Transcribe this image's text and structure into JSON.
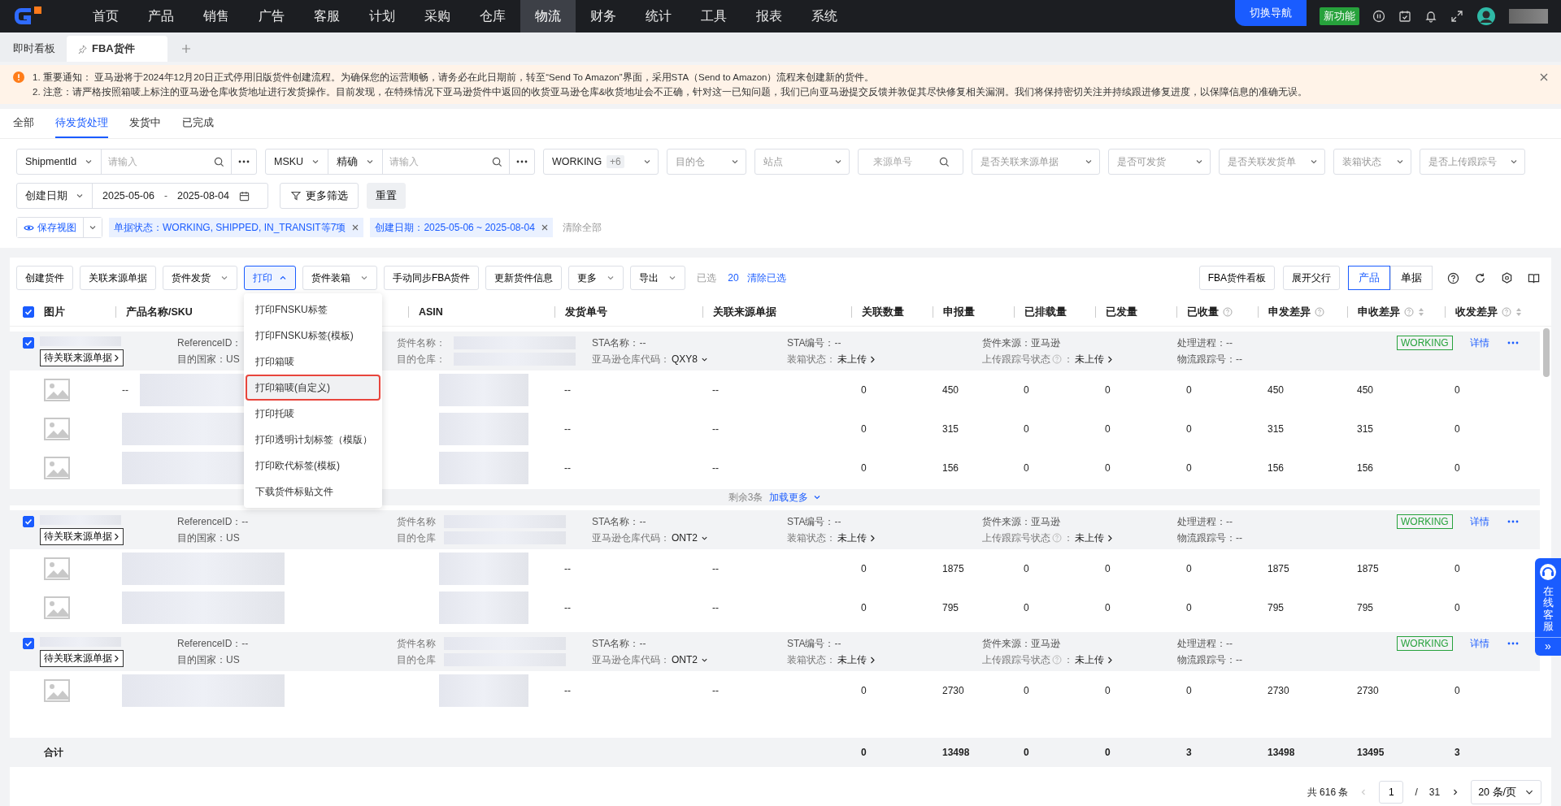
{
  "nav": {
    "menu": [
      {
        "label": "首页",
        "selected": false
      },
      {
        "label": "产品",
        "selected": false
      },
      {
        "label": "销售",
        "selected": false
      },
      {
        "label": "广告",
        "selected": false
      },
      {
        "label": "客服",
        "selected": false
      },
      {
        "label": "计划",
        "selected": false
      },
      {
        "label": "采购",
        "selected": false
      },
      {
        "label": "仓库",
        "selected": false
      },
      {
        "label": "物流",
        "selected": true
      },
      {
        "label": "财务",
        "selected": false
      },
      {
        "label": "统计",
        "selected": false
      },
      {
        "label": "工具",
        "selected": false
      },
      {
        "label": "报表",
        "selected": false
      },
      {
        "label": "系统",
        "selected": false
      }
    ],
    "switch_button": "切换导航",
    "new_feature": "新功能"
  },
  "page_tabs": [
    {
      "label": "即时看板",
      "selected": false,
      "pinned": false
    },
    {
      "label": "FBA货件",
      "selected": true,
      "pinned": true
    }
  ],
  "notices": [
    "1. 重要通知： 亚马逊将于2024年12月20日正式停用旧版货件创建流程。为确保您的运营顺畅，请务必在此日期前，转至“Send To Amazon”界面，采用STA（Send to Amazon）流程来创建新的货件。",
    "2. 注意：请严格按照箱唛上标注的亚马逊仓库收货地址进行发货操作。目前发现，在特殊情况下亚马逊货件中返回的收货亚马逊仓库&收货地址会不正确，针对这一已知问题，我们已向亚马逊提交反馈并敦促其尽快修复相关漏洞。我们将保持密切关注并持续跟进修复进度，以保障信息的准确无误。"
  ],
  "status_tabs": [
    {
      "label": "全部",
      "selected": false
    },
    {
      "label": "待发货处理",
      "selected": true
    },
    {
      "label": "发货中",
      "selected": false
    },
    {
      "label": "已完成",
      "selected": false
    }
  ],
  "filters": [
    {
      "kind": "combo",
      "select": "ShipmentId",
      "placeholder": "请输入"
    },
    {
      "kind": "combo",
      "select": "MSKU",
      "mode": "精确",
      "placeholder": "请输入"
    },
    {
      "kind": "select",
      "value": "WORKING",
      "count": "+6"
    },
    {
      "kind": "select",
      "placeholder": "目的仓"
    },
    {
      "kind": "select",
      "placeholder": "站点"
    },
    {
      "kind": "search",
      "placeholder": "来源单号"
    },
    {
      "kind": "select",
      "placeholder": "是否关联来源单据"
    },
    {
      "kind": "select",
      "placeholder": "是否可发货"
    },
    {
      "kind": "select",
      "placeholder": "是否关联发货单"
    },
    {
      "kind": "select",
      "placeholder": "装箱状态"
    },
    {
      "kind": "select",
      "placeholder": "是否上传跟踪号"
    },
    {
      "kind": "daterange",
      "select": "创建日期",
      "start": "2025-05-06",
      "sep": "-",
      "end": "2025-08-04"
    },
    {
      "kind": "button",
      "label": "更多筛选"
    },
    {
      "kind": "reset",
      "label": "重置"
    }
  ],
  "view_button": "保存视图",
  "chips": [
    "单据状态：WORKING, SHIPPED, IN_TRANSIT等7项",
    "创建日期：2025-05-06 ~ 2025-08-04"
  ],
  "clear_all": "清除全部",
  "toolbar": [
    {
      "label": "创建货件",
      "caret": false,
      "open": false
    },
    {
      "label": "关联来源单据",
      "caret": false,
      "open": false
    },
    {
      "label": "货件发货",
      "caret": true,
      "open": false
    },
    {
      "label": "打印",
      "caret": true,
      "open": true
    },
    {
      "label": "货件装箱",
      "caret": true,
      "open": false
    },
    {
      "label": "手动同步FBA货件",
      "caret": false,
      "open": false
    },
    {
      "label": "更新货件信息",
      "caret": false,
      "open": false
    },
    {
      "label": "更多",
      "caret": true,
      "open": false
    },
    {
      "label": "导出",
      "caret": true,
      "open": false
    }
  ],
  "selection": {
    "label": "已选",
    "count": "20",
    "clear": "清除已选"
  },
  "right_buttons": [
    "FBA货件看板",
    "展开父行"
  ],
  "segments": [
    {
      "label": "产品",
      "selected": true
    },
    {
      "label": "单据",
      "selected": false
    }
  ],
  "print_menu": [
    {
      "label": "打印FNSKU标签",
      "highlighted": false
    },
    {
      "label": "打印FNSKU标签(模板)",
      "highlighted": false
    },
    {
      "label": "打印箱唛",
      "highlighted": false
    },
    {
      "label": "打印箱唛(自定义)",
      "highlighted": true
    },
    {
      "label": "打印托唛",
      "highlighted": false
    },
    {
      "label": "打印透明计划标签（模版）",
      "highlighted": false
    },
    {
      "label": "打印欧代标签(模板)",
      "highlighted": false
    },
    {
      "label": "下载货件标贴文件",
      "highlighted": false
    }
  ],
  "table": {
    "all_checked": true,
    "columns": [
      {
        "label": "图片",
        "help": false,
        "sortable": false
      },
      {
        "label": "产品名称/SKU",
        "help": false,
        "sortable": false
      },
      {
        "label": "ASIN",
        "help": false,
        "sortable": false
      },
      {
        "label": "发货单号",
        "help": false,
        "sortable": false
      },
      {
        "label": "关联来源单据",
        "help": false,
        "sortable": false
      },
      {
        "label": "关联数量",
        "help": false,
        "sortable": false
      },
      {
        "label": "申报量",
        "help": false,
        "sortable": false
      },
      {
        "label": "已排载量",
        "help": false,
        "sortable": false
      },
      {
        "label": "已发量",
        "help": false,
        "sortable": false
      },
      {
        "label": "已收量",
        "help": true,
        "sortable": false
      },
      {
        "label": "申发差异",
        "help": true,
        "sortable": false
      },
      {
        "label": "申收差异",
        "help": true,
        "sortable": true
      },
      {
        "label": "收发差异",
        "help": true,
        "sortable": true
      }
    ],
    "groups": [
      {
        "checked": true,
        "badge": "待关联来源单据",
        "status": "WORKING",
        "detail": "详情",
        "fields": [
          {
            "text": "ReferenceID："
          },
          {
            "text": "目的国家：US"
          },
          {
            "label": "货件名称：",
            "kind": "blurred"
          },
          {
            "label": "目的仓库：",
            "kind": "blurred"
          },
          {
            "text": "STA名称：--"
          },
          {
            "label": "亚马逊仓库代码：",
            "value": "QXY8",
            "kind": "dropdown"
          },
          {
            "text": "STA编号：--"
          },
          {
            "label": "装箱状态：",
            "value": "未上传",
            "kind": "link"
          },
          {
            "text": "货件来源：亚马逊"
          },
          {
            "label": "上传跟踪号状态",
            "help": true,
            "suffix": "：",
            "value": "未上传",
            "kind": "link"
          },
          {
            "text": "处理进程：--"
          },
          {
            "text": "物流跟踪号：--"
          }
        ],
        "items": [
          {
            "sku": "--",
            "ship_no": "--",
            "source": "--",
            "values": [
              "0",
              "450",
              "0",
              "0",
              "0",
              "450",
              "450",
              "0"
            ]
          },
          {
            "ship_no": "--",
            "source": "--",
            "values": [
              "0",
              "315",
              "0",
              "0",
              "0",
              "315",
              "315",
              "0"
            ]
          },
          {
            "ship_no": "--",
            "source": "--",
            "values": [
              "0",
              "156",
              "0",
              "0",
              "0",
              "156",
              "156",
              "0"
            ]
          }
        ],
        "more": {
          "remaining": "剩余3条",
          "load": "加载更多"
        }
      },
      {
        "checked": true,
        "badge": "待关联来源单据",
        "status": "WORKING",
        "detail": "详情",
        "fields": [
          {
            "text": "ReferenceID：--"
          },
          {
            "text": "目的国家：US"
          },
          {
            "label": "货件名称",
            "kind": "blurred"
          },
          {
            "label": "目的仓库",
            "kind": "blurred"
          },
          {
            "text": "STA名称：--"
          },
          {
            "label": "亚马逊仓库代码：",
            "value": "ONT2",
            "kind": "dropdown"
          },
          {
            "text": "STA编号：--"
          },
          {
            "label": "装箱状态：",
            "value": "未上传",
            "kind": "link"
          },
          {
            "text": "货件来源：亚马逊"
          },
          {
            "label": "上传跟踪号状态",
            "help": true,
            "suffix": "：",
            "value": "未上传",
            "kind": "link"
          },
          {
            "text": "处理进程：--"
          },
          {
            "text": "物流跟踪号：--"
          }
        ],
        "items": [
          {
            "ship_no": "--",
            "source": "--",
            "values": [
              "0",
              "1875",
              "0",
              "0",
              "0",
              "1875",
              "1875",
              "0"
            ]
          },
          {
            "ship_no": "--",
            "source": "--",
            "values": [
              "0",
              "795",
              "0",
              "0",
              "0",
              "795",
              "795",
              "0"
            ]
          }
        ]
      },
      {
        "checked": true,
        "badge": "待关联来源单据",
        "status": "WORKING",
        "detail": "详情",
        "fields": [
          {
            "text": "ReferenceID：--"
          },
          {
            "text": "目的国家：US"
          },
          {
            "label": "货件名称",
            "kind": "blurred"
          },
          {
            "label": "目的仓库",
            "kind": "blurred"
          },
          {
            "text": "STA名称：--"
          },
          {
            "label": "亚马逊仓库代码：",
            "value": "ONT2",
            "kind": "dropdown"
          },
          {
            "text": "STA编号：--"
          },
          {
            "label": "装箱状态：",
            "value": "未上传",
            "kind": "link"
          },
          {
            "text": "货件来源：亚马逊"
          },
          {
            "label": "上传跟踪号状态",
            "help": true,
            "suffix": "：",
            "value": "未上传",
            "kind": "link"
          },
          {
            "text": "处理进程：--"
          },
          {
            "text": "物流跟踪号：--"
          }
        ],
        "items": [
          {
            "ship_no": "--",
            "source": "--",
            "values": [
              "0",
              "2730",
              "0",
              "0",
              "0",
              "2730",
              "2730",
              "0"
            ]
          }
        ]
      }
    ],
    "totals": {
      "label": "合计",
      "values": [
        "0",
        "13498",
        "0",
        "0",
        "3",
        "13498",
        "13495",
        "3"
      ]
    }
  },
  "pagination": {
    "total": "共 616 条",
    "page": "1",
    "sep": "/",
    "pages": "31",
    "page_size": "20 条/页"
  },
  "service": {
    "label": "在线客服",
    "expand": "»"
  }
}
